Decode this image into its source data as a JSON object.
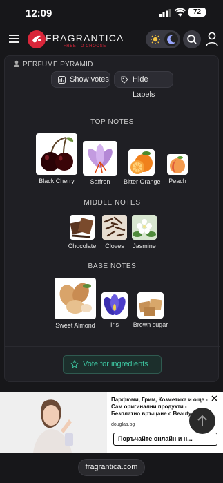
{
  "status_bar": {
    "time": "12:09",
    "battery": "72"
  },
  "header": {
    "brand": "FRAGRANTICA",
    "tagline": "FREE TO CHOOSE"
  },
  "pyramid": {
    "heading": "PERFUME PYRAMID",
    "show_votes": "Show votes",
    "hide_labels": "Hide Labels",
    "top": {
      "title": "TOP NOTES",
      "items": [
        "Black Cherry",
        "Saffron",
        "Bitter Orange",
        "Peach"
      ]
    },
    "middle": {
      "title": "MIDDLE NOTES",
      "items": [
        "Chocolate",
        "Cloves",
        "Jasmine"
      ]
    },
    "base": {
      "title": "BASE NOTES",
      "items": [
        "Sweet Almond",
        "Iris",
        "Brown sugar"
      ]
    },
    "vote": "Vote for ingredients"
  },
  "ad": {
    "title": "Парфюми, Грим, Козметика и още - Сам оригинални продукти - Безплатно връщане с Beautycard",
    "domain": "douglas.bg",
    "cta": "Поръчайте онлайн и н..."
  },
  "url": "fragrantica.com",
  "colors": {
    "accent": "#3ec7a2",
    "brand": "#d9263a",
    "background": "#17171a"
  }
}
